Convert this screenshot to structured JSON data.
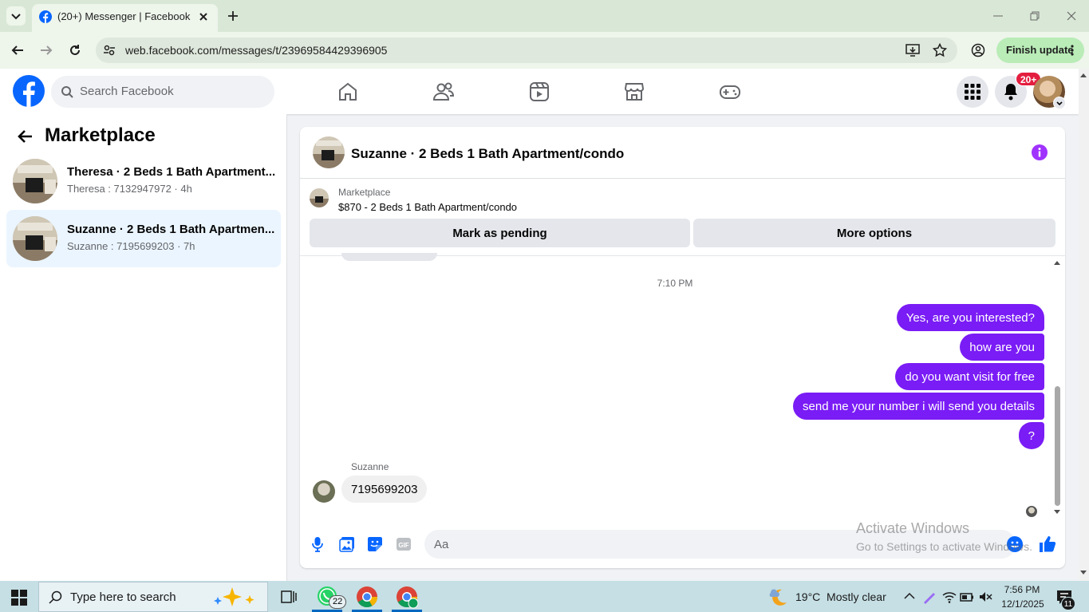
{
  "browser": {
    "tab_title": "(20+) Messenger | Facebook",
    "url": "web.facebook.com/messages/t/23969584429396905",
    "finish_update_label": "Finish update"
  },
  "facebook": {
    "search_placeholder": "Search Facebook",
    "notification_badge": "20+"
  },
  "sidebar": {
    "title": "Marketplace",
    "conversations": [
      {
        "title": "Theresa · 2 Beds 1 Bath Apartment...",
        "subtitle": "Theresa : 7132947972 · 4h",
        "selected": false
      },
      {
        "title": "Suzanne · 2 Beds 1 Bath Apartmen...",
        "subtitle": "Suzanne : 7195699203 · 7h",
        "selected": true
      }
    ]
  },
  "chat": {
    "title": "Suzanne · 2 Beds 1 Bath Apartment/condo",
    "listing_source": "Marketplace",
    "listing_price": "$870 - 2 Beds 1 Bath Apartment/condo",
    "mark_pending_label": "Mark as pending",
    "more_options_label": "More options",
    "timestamp": "7:10 PM",
    "outgoing": [
      "Yes, are you interested?",
      "how are you",
      "do you want visit for free",
      "send me your number i will send you details",
      "?"
    ],
    "incoming_sender": "Suzanne",
    "incoming_message": "7195699203",
    "composer_placeholder": "Aa",
    "accent_color": "#7a1cf5"
  },
  "watermark": {
    "line1": "Activate Windows",
    "line2": "Go to Settings to activate Windows."
  },
  "taskbar": {
    "search_placeholder": "Type here to search",
    "whatsapp_badge": "22",
    "weather": "19°C  Mostly clear",
    "time": "7:56 PM",
    "date": "12/1/2025",
    "notification_count": "11"
  }
}
